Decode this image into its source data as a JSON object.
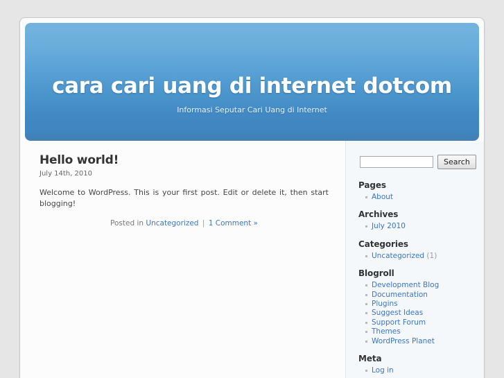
{
  "site": {
    "title": "cara cari uang di internet dotcom",
    "tagline": "Informasi Seputar Cari Uang di Internet",
    "header_gradient_top": "#74b3df",
    "header_gradient_bottom": "#437fb4",
    "page_background": "#e6e6e6",
    "link_color": "#3a75c4"
  },
  "post": {
    "title": "Hello world!",
    "date": "July 14th, 2010",
    "body": "Welcome to WordPress. This is your first post. Edit or delete it, then start blogging!",
    "meta_prefix": "Posted in",
    "category": "Uncategorized",
    "separator": "|",
    "comments": "1 Comment »"
  },
  "sidebar": {
    "search": {
      "value": "",
      "placeholder": "",
      "button_label": "Search"
    },
    "widgets": [
      {
        "title": "Pages",
        "items": [
          {
            "label": "About",
            "count": ""
          }
        ]
      },
      {
        "title": "Archives",
        "items": [
          {
            "label": "July 2010",
            "count": ""
          }
        ]
      },
      {
        "title": "Categories",
        "items": [
          {
            "label": "Uncategorized",
            "count": "(1)"
          }
        ]
      },
      {
        "title": "Blogroll",
        "items": [
          {
            "label": "Development Blog",
            "count": ""
          },
          {
            "label": "Documentation",
            "count": ""
          },
          {
            "label": "Plugins",
            "count": ""
          },
          {
            "label": "Suggest Ideas",
            "count": ""
          },
          {
            "label": "Support Forum",
            "count": ""
          },
          {
            "label": "Themes",
            "count": ""
          },
          {
            "label": "WordPress Planet",
            "count": ""
          }
        ]
      },
      {
        "title": "Meta",
        "items": [
          {
            "label": "Log in",
            "count": ""
          }
        ]
      }
    ]
  }
}
